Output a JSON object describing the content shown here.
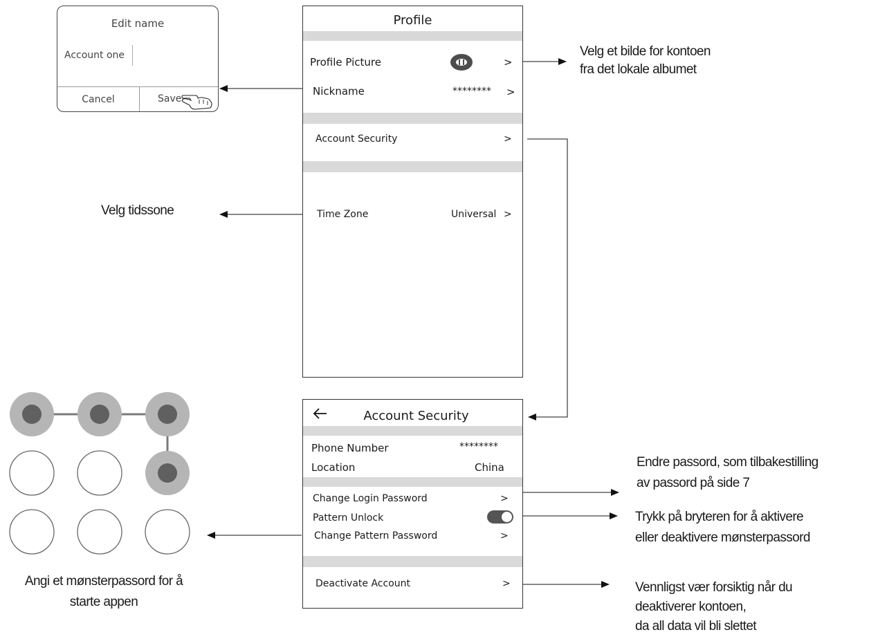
{
  "edit_dialog": {
    "title": "Edit name",
    "input_value": "Account one",
    "cancel_label": "Cancel",
    "save_label": "Save"
  },
  "profile": {
    "title": "Profile",
    "picture_label": "Profile Picture",
    "picture_chevron": ">",
    "nickname_label": "Nickname",
    "nickname_value": "********",
    "nickname_chevron": ">",
    "security_label": "Account Security",
    "security_chevron": ">",
    "timezone_label": "Time Zone",
    "timezone_value": "Universal",
    "timezone_chevron": ">"
  },
  "security": {
    "back_icon": "back-arrow-icon",
    "title": "Account Security",
    "phone_label": "Phone Number",
    "phone_value": "********",
    "location_label": "Location",
    "location_value": "China",
    "change_login_label": "Change Login Password",
    "change_login_chevron": ">",
    "pattern_unlock_label": "Pattern Unlock",
    "pattern_unlock_on": true,
    "change_pattern_label": "Change Pattern Password",
    "change_pattern_chevron": ">",
    "deactivate_label": "Deactivate Account",
    "deactivate_chevron": ">"
  },
  "pattern": {
    "selected": [
      true,
      true,
      true,
      false,
      false,
      true,
      false,
      false,
      false
    ]
  },
  "annotations": {
    "profile_picture": [
      "Velg et bilde for kontoen",
      "fra det lokale albumet"
    ],
    "timezone": [
      "Velg tidssone"
    ],
    "change_password": [
      "Endre passord, som tilbakestilling",
      "av passord på side 7"
    ],
    "pattern_toggle": [
      "Trykk på bryteren for å aktivere",
      "eller deaktivere mønsterpassord"
    ],
    "deactivate": [
      "Vennligst vær forsiktig når du",
      "deaktiverer kontoen,",
      "da all data vil bli slettet"
    ],
    "pattern_set": [
      "Angi et mønsterpassord for å",
      "starte appen"
    ]
  },
  "colors": {
    "band": "#d9d9d9",
    "node_outer": "#b5b5b5",
    "node_inner": "#606060",
    "connector": "#7a7a7a"
  }
}
